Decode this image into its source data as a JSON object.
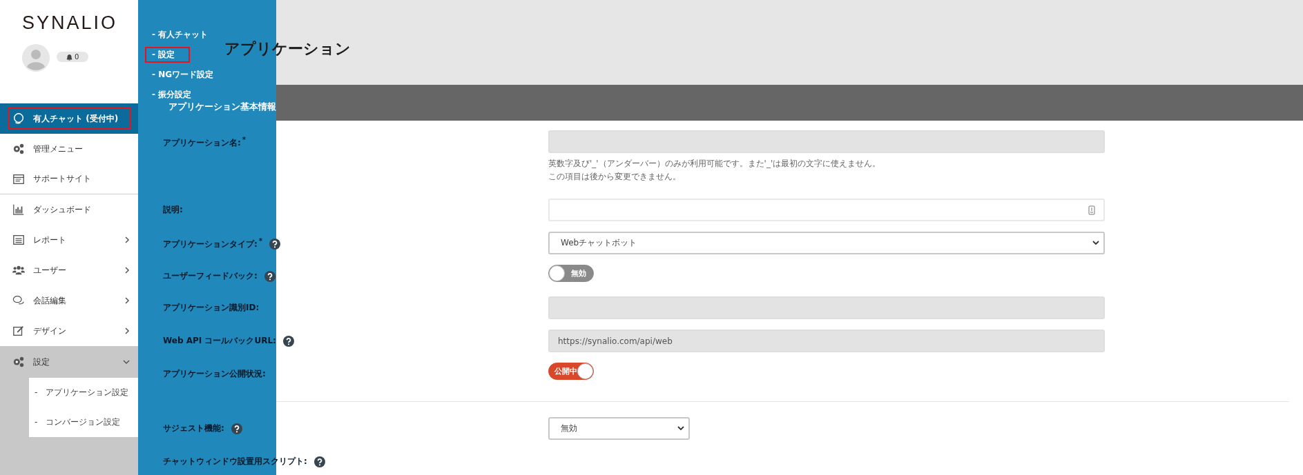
{
  "sidebar": {
    "logo": "SYNALIO",
    "notification_count": "0",
    "items": [
      {
        "label": "有人チャット (受付中)",
        "kind": "headset",
        "selected": true,
        "highlighted": true
      },
      {
        "label": "管理メニュー",
        "kind": "gears",
        "selected": false,
        "highlighted": false
      },
      {
        "label": "サポートサイト",
        "kind": "browser",
        "selected": false,
        "highlighted": false,
        "divider_after": true
      },
      {
        "label": "ダッシュボード",
        "kind": "chart",
        "selected": false,
        "highlighted": false
      },
      {
        "label": "レポート",
        "kind": "list",
        "selected": false,
        "highlighted": false,
        "expanded": false
      },
      {
        "label": "ユーザー",
        "kind": "users",
        "selected": false,
        "highlighted": false,
        "expanded": false
      },
      {
        "label": "会話編集",
        "kind": "chat",
        "selected": false,
        "highlighted": false,
        "expanded": false
      },
      {
        "label": "デザイン",
        "kind": "edit",
        "selected": false,
        "highlighted": false,
        "expanded": false
      },
      {
        "label": "設定",
        "kind": "gears",
        "selected": false,
        "expanded": true,
        "highlighted": false,
        "children": [
          {
            "label": "-　アプリケーション設定"
          },
          {
            "label": "-　コンバージョン設定"
          }
        ]
      }
    ]
  },
  "flyout_menu": [
    {
      "label": "- 有人チャット",
      "highlighted": false
    },
    {
      "label": "- 設定",
      "highlighted": true
    },
    {
      "label": "- NGワード設定",
      "highlighted": false
    },
    {
      "label": "- 振分設定",
      "highlighted": false
    }
  ],
  "page_title": "アプリケーション",
  "section_title": "アプリケーション基本情報",
  "form": [
    {
      "kind": "text",
      "label": "アプリケーション名:",
      "required_mark": "*",
      "help": false,
      "hint": [
        "英数字及び'_'（アンダーバー）のみが利用可能です。また'_'は最初の文字に使えません。",
        "この項目は後から変更できません。"
      ],
      "disabled": true
    },
    {
      "kind": "text",
      "label": "説明:",
      "help": false,
      "disabled": false,
      "field_icon": true
    },
    {
      "kind": "select",
      "label": "アプリケーションタイプ:",
      "required_mark": "*",
      "help": true,
      "value": "Webチャットボット",
      "wide": true
    },
    {
      "kind": "toggle",
      "label": "ユーザーフィードバック:",
      "help": true,
      "on": false,
      "text": "無効"
    },
    {
      "kind": "text",
      "label": "アプリケーション識別ID:",
      "help": false,
      "disabled": true
    },
    {
      "kind": "text",
      "label": "Web API コールバックURL:",
      "help": true,
      "value": "https://synalio.com/api/web",
      "disabled": true
    },
    {
      "kind": "toggle",
      "label": "アプリケーション公開状況:",
      "help": false,
      "on": true,
      "text": "公開中"
    },
    {
      "kind": "divider"
    },
    {
      "kind": "select",
      "label": "サジェスト機能:",
      "help": true,
      "value": "無効",
      "wide": false
    },
    {
      "kind": "heading",
      "label": "チャットウィンドウ設置用スクリプト:",
      "help": true
    }
  ]
}
